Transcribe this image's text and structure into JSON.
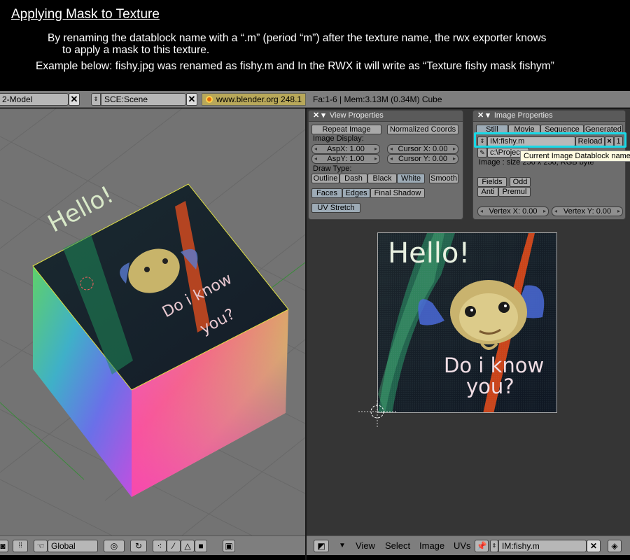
{
  "header": {
    "title": "Applying Mask to Texture",
    "line1": "By renaming the datablock name with a “.m” (period “m”) after the texture name, the rwx exporter knows",
    "line2": "to apply a mask to this texture.",
    "line3": "Example below: fishy.jpg was renamed as fishy.m and In the RWX it will write as “Texture fishy mask fishym”"
  },
  "topbar": {
    "screen": "2-Model",
    "scene": "SCE:Scene",
    "url": "www.blender.org 248.1",
    "stats": "Fa:1-6 | Mem:3.13M (0.34M) Cube"
  },
  "view_properties": {
    "title": "View Properties",
    "repeat_image": "Repeat Image",
    "normalized_coords": "Normalized Coords",
    "image_display_label": "Image Display:",
    "aspx": "AspX: 1.00",
    "aspy": "AspY: 1.00",
    "cursor_x": "Cursor X: 0.00",
    "cursor_y": "Cursor Y: 0.00",
    "draw_type_label": "Draw Type:",
    "draw_types": [
      "Outline",
      "Dash",
      "Black",
      "White",
      "Smooth"
    ],
    "faces": "Faces",
    "edges": "Edges",
    "final_shadow": "Final Shadow",
    "uv_stretch": "UV Stretch"
  },
  "image_properties": {
    "title": "Image Properties",
    "tabs": [
      "Still",
      "Movie",
      "Sequence",
      "Generated"
    ],
    "image_name": "IM:fishy.m",
    "reload": "Reload",
    "close": "×",
    "users": "1",
    "path": "c:\\Projec",
    "image_info": "Image : size 256 x 256, RGB byte",
    "fields": "Fields",
    "odd": "Odd",
    "anti": "Anti",
    "premul": "Premul",
    "vertex_x": "Vertex X: 0.00",
    "vertex_y": "Vertex Y: 0.00",
    "tooltip": "Current Image Datablock name."
  },
  "texture_image": {
    "hello": "Hello!",
    "question_line1": "Do i know",
    "question_line2": "you?"
  },
  "viewport_bottom": {
    "orientation": "Global"
  },
  "image_editor_bottom": {
    "menus": [
      "View",
      "Select",
      "Image",
      "UVs"
    ],
    "image_name": "IM:fishy.m"
  },
  "colors": {
    "highlight": "#18d8e6",
    "panel_bg": "#6d6d6d",
    "viewport_bg": "#737373",
    "image_editor_bg": "#353535"
  }
}
